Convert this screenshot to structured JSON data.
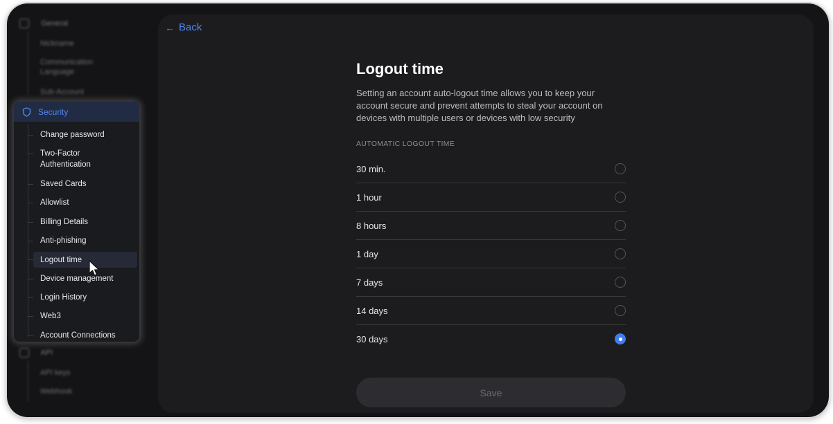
{
  "sidebar": {
    "blurred_top": {
      "group": "General",
      "items": [
        "Nickname",
        "Communication Language",
        "Sub-Account"
      ]
    },
    "security": {
      "label": "Security",
      "items": [
        "Change password",
        "Two-Factor Authentication",
        "Saved Cards",
        "Allowlist",
        "Billing Details",
        "Anti-phishing",
        "Logout time",
        "Device management",
        "Login History",
        "Web3",
        "Account Connections"
      ],
      "active_index": 6
    },
    "blurred_bottom": {
      "group": "API",
      "items": [
        "API keys",
        "Webhook"
      ]
    }
  },
  "main": {
    "back_label": "Back",
    "title": "Logout time",
    "description": "Setting an account auto-logout time allows you to keep your account secure and prevent attempts to steal your account on devices with multiple users or devices with low security",
    "section_label": "AUTOMATIC LOGOUT TIME",
    "options": [
      {
        "label": "30 min.",
        "selected": false
      },
      {
        "label": "1 hour",
        "selected": false
      },
      {
        "label": "8 hours",
        "selected": false
      },
      {
        "label": "1 day",
        "selected": false
      },
      {
        "label": "7 days",
        "selected": false
      },
      {
        "label": "14 days",
        "selected": false
      },
      {
        "label": "30 days",
        "selected": true
      }
    ],
    "save_label": "Save"
  },
  "colors": {
    "accent": "#3f7ef0",
    "panel_bg": "#1c1c1f",
    "page_bg": "#141416"
  }
}
